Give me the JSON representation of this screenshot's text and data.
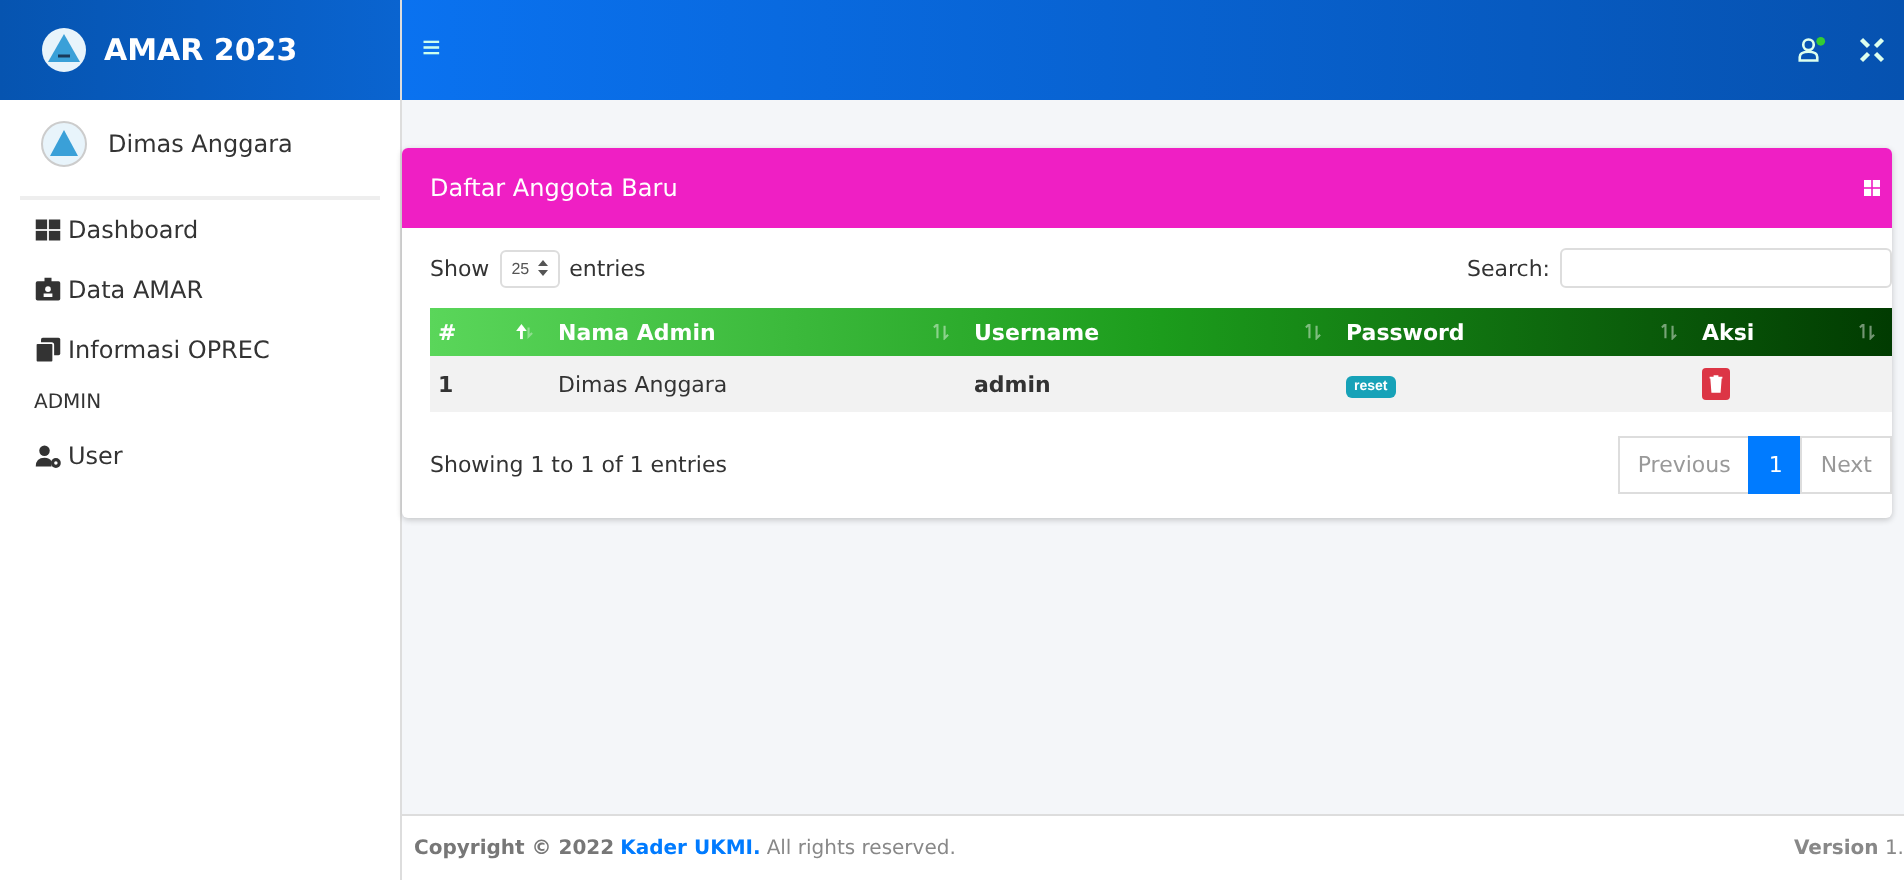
{
  "brand": {
    "title": "AMAR 2023"
  },
  "user": {
    "name": "Dimas Anggara"
  },
  "sidebar": {
    "items": [
      {
        "kind": "link",
        "label": "Dashboard"
      },
      {
        "kind": "link",
        "label": "Data AMAR"
      },
      {
        "kind": "link",
        "label": "Informasi OPREC"
      },
      {
        "kind": "header",
        "label": "ADMIN"
      },
      {
        "kind": "link",
        "label": "User"
      }
    ]
  },
  "topbar": {
    "menu_glyph": "≡",
    "user_online": true
  },
  "card": {
    "title": "Daftar Anggota Baru",
    "show_label": "Show",
    "page_size": "25",
    "entries_label": "entries",
    "search_label": "Search:",
    "table": {
      "columns": [
        {
          "label": "#",
          "sorted": true
        },
        {
          "label": "Nama Admin",
          "sorted": false
        },
        {
          "label": "Username",
          "sorted": false
        },
        {
          "label": "Password",
          "sorted": false
        },
        {
          "label": "Aksi",
          "sorted": false
        }
      ],
      "rows": [
        {
          "no": "1",
          "name": "Dimas Anggara",
          "username": "admin",
          "password_action": "reset"
        }
      ]
    },
    "info": "Showing 1 to 1 of 1 entries",
    "pagination": [
      {
        "label": "Previous",
        "selected": false
      },
      {
        "label": "1",
        "selected": true
      },
      {
        "label": "Next",
        "selected": false
      }
    ]
  },
  "footer": {
    "copyright": "Copyright © 2022",
    "link": "Kader UKMI.",
    "rest": "All rights reserved.",
    "version": "**Version** 1."
  }
}
